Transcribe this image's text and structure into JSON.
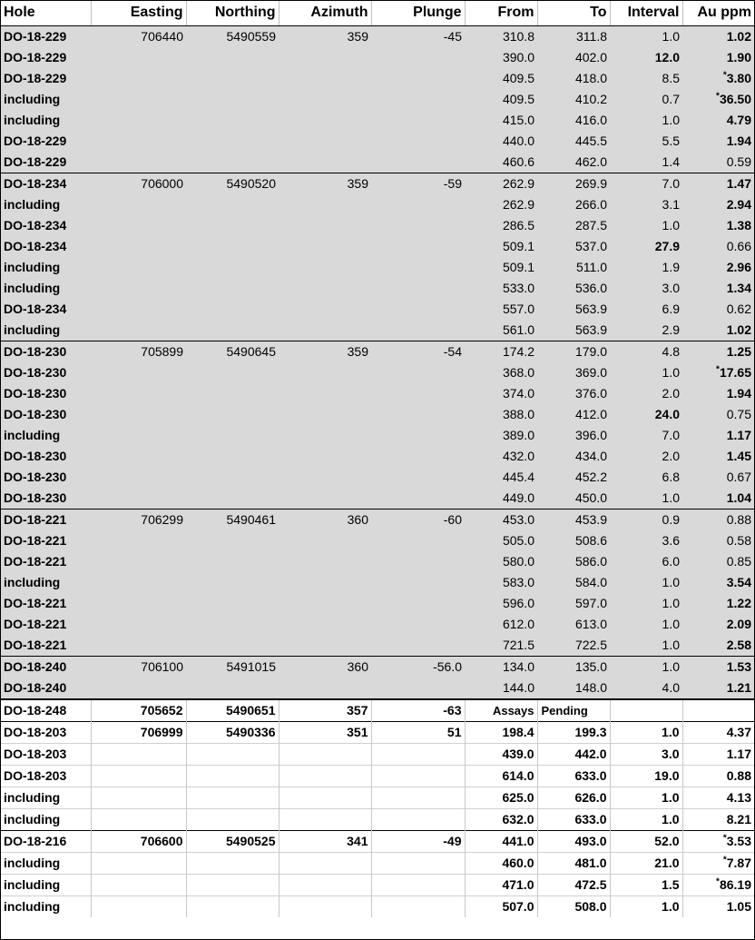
{
  "columns": [
    "Hole",
    "Easting",
    "Northing",
    "Azimuth",
    "Plunge",
    "From",
    "To",
    "Interval",
    "Au ppm"
  ],
  "groups": [
    {
      "style": "shaded",
      "rows": [
        {
          "hole": "DO-18-229",
          "easting": "706440",
          "northing": "5490559",
          "azimuth": "359",
          "plunge": "-45",
          "from": "310.8",
          "to": "311.8",
          "interval": "1.0",
          "au": "1.02",
          "au_bold": true
        },
        {
          "hole": "DO-18-229",
          "from": "390.0",
          "to": "402.0",
          "interval": "12.0",
          "interval_bold": true,
          "au": "1.90",
          "au_bold": true
        },
        {
          "hole": "DO-18-229",
          "from": "409.5",
          "to": "418.0",
          "interval": "8.5",
          "au": "3.80",
          "au_bold": true,
          "au_ast": true
        },
        {
          "hole": "including",
          "from": "409.5",
          "to": "410.2",
          "interval": "0.7",
          "au": "36.50",
          "au_bold": true,
          "au_ast": true
        },
        {
          "hole": "including",
          "from": "415.0",
          "to": "416.0",
          "interval": "1.0",
          "au": "4.79",
          "au_bold": true
        },
        {
          "hole": "DO-18-229",
          "from": "440.0",
          "to": "445.5",
          "interval": "5.5",
          "au": "1.94",
          "au_bold": true
        },
        {
          "hole": "DO-18-229",
          "from": "460.6",
          "to": "462.0",
          "interval": "1.4",
          "au": "0.59"
        }
      ]
    },
    {
      "style": "shaded",
      "rows": [
        {
          "hole": "DO-18-234",
          "easting": "706000",
          "northing": "5490520",
          "azimuth": "359",
          "plunge": "-59",
          "from": "262.9",
          "to": "269.9",
          "interval": "7.0",
          "au": "1.47",
          "au_bold": true
        },
        {
          "hole": "including",
          "from": "262.9",
          "to": "266.0",
          "interval": "3.1",
          "au": "2.94",
          "au_bold": true
        },
        {
          "hole": "DO-18-234",
          "from": "286.5",
          "to": "287.5",
          "interval": "1.0",
          "au": "1.38",
          "au_bold": true
        },
        {
          "hole": "DO-18-234",
          "from": "509.1",
          "to": "537.0",
          "interval": "27.9",
          "interval_bold": true,
          "au": "0.66"
        },
        {
          "hole": "including",
          "from": "509.1",
          "to": "511.0",
          "interval": "1.9",
          "au": "2.96",
          "au_bold": true
        },
        {
          "hole": "including",
          "from": "533.0",
          "to": "536.0",
          "interval": "3.0",
          "au": "1.34",
          "au_bold": true
        },
        {
          "hole": "DO-18-234",
          "from": "557.0",
          "to": "563.9",
          "interval": "6.9",
          "au": "0.62"
        },
        {
          "hole": "including",
          "from": "561.0",
          "to": "563.9",
          "interval": "2.9",
          "au": "1.02",
          "au_bold": true
        }
      ]
    },
    {
      "style": "shaded",
      "rows": [
        {
          "hole": "DO-18-230",
          "easting": "705899",
          "northing": "5490645",
          "azimuth": "359",
          "plunge": "-54",
          "from": "174.2",
          "to": "179.0",
          "interval": "4.8",
          "au": "1.25",
          "au_bold": true
        },
        {
          "hole": "DO-18-230",
          "from": "368.0",
          "to": "369.0",
          "interval": "1.0",
          "au": "17.65",
          "au_bold": true,
          "au_ast": true
        },
        {
          "hole": "DO-18-230",
          "from": "374.0",
          "to": "376.0",
          "interval": "2.0",
          "au": "1.94",
          "au_bold": true
        },
        {
          "hole": "DO-18-230",
          "from": "388.0",
          "to": "412.0",
          "interval": "24.0",
          "interval_bold": true,
          "au": "0.75"
        },
        {
          "hole": "including",
          "from": "389.0",
          "to": "396.0",
          "interval": "7.0",
          "au": "1.17",
          "au_bold": true
        },
        {
          "hole": "DO-18-230",
          "from": "432.0",
          "to": "434.0",
          "interval": "2.0",
          "au": "1.45",
          "au_bold": true
        },
        {
          "hole": "DO-18-230",
          "from": "445.4",
          "to": "452.2",
          "interval": "6.8",
          "au": "0.67"
        },
        {
          "hole": "DO-18-230",
          "from": "449.0",
          "to": "450.0",
          "interval": "1.0",
          "au": "1.04",
          "au_bold": true
        }
      ]
    },
    {
      "style": "shaded",
      "rows": [
        {
          "hole": "DO-18-221",
          "easting": "706299",
          "northing": "5490461",
          "azimuth": "360",
          "plunge": "-60",
          "from": "453.0",
          "to": "453.9",
          "interval": "0.9",
          "au": "0.88"
        },
        {
          "hole": "DO-18-221",
          "from": "505.0",
          "to": "508.6",
          "interval": "3.6",
          "au": "0.58"
        },
        {
          "hole": "DO-18-221",
          "from": "580.0",
          "to": "586.0",
          "interval": "6.0",
          "au": "0.85"
        },
        {
          "hole": "including",
          "from": "583.0",
          "to": "584.0",
          "interval": "1.0",
          "au": "3.54",
          "au_bold": true
        },
        {
          "hole": "DO-18-221",
          "from": "596.0",
          "to": "597.0",
          "interval": "1.0",
          "au": "1.22",
          "au_bold": true
        },
        {
          "hole": "DO-18-221",
          "from": "612.0",
          "to": "613.0",
          "interval": "1.0",
          "au": "2.09",
          "au_bold": true
        },
        {
          "hole": "DO-18-221",
          "from": "721.5",
          "to": "722.5",
          "interval": "1.0",
          "au": "2.58",
          "au_bold": true
        }
      ]
    },
    {
      "style": "shaded",
      "rows": [
        {
          "hole": "DO-18-240",
          "easting": "706100",
          "northing": "5491015",
          "azimuth": "360",
          "plunge": "-56.0",
          "from": "134.0",
          "to": "135.0",
          "interval": "1.0",
          "au": "1.53",
          "au_bold": true
        },
        {
          "hole": "DO-18-240",
          "from": "144.0",
          "to": "148.0",
          "interval": "4.0",
          "au": "1.21",
          "au_bold": true
        }
      ]
    },
    {
      "style": "pending",
      "rows": [
        {
          "hole": "DO-18-248",
          "easting": "705652",
          "northing": "5490651",
          "azimuth": "357",
          "plunge": "-63",
          "from": "Assays",
          "to": "Pending",
          "interval": "",
          "au": ""
        }
      ]
    },
    {
      "style": "white",
      "rows": [
        {
          "hole": "DO-18-203",
          "easting": "706999",
          "northing": "5490336",
          "azimuth": "351",
          "plunge": "51",
          "from": "198.4",
          "to": "199.3",
          "interval": "1.0",
          "au": "4.37",
          "au_bold": true
        },
        {
          "hole": "DO-18-203",
          "from": "439.0",
          "to": "442.0",
          "interval": "3.0",
          "au": "1.17",
          "au_bold": true
        },
        {
          "hole": "DO-18-203",
          "from": "614.0",
          "to": "633.0",
          "interval": "19.0",
          "interval_bold": true,
          "au": "0.88"
        },
        {
          "hole": "including",
          "from": "625.0",
          "to": "626.0",
          "interval": "1.0",
          "au": "4.13",
          "au_bold": true
        },
        {
          "hole": "including",
          "from": "632.0",
          "to": "633.0",
          "interval": "1.0",
          "au": "8.21",
          "au_bold": true
        }
      ]
    },
    {
      "style": "white",
      "rows": [
        {
          "hole": "DO-18-216",
          "easting": "706600",
          "northing": "5490525",
          "azimuth": "341",
          "plunge": "-49",
          "from": "441.0",
          "to": "493.0",
          "interval": "52.0",
          "interval_bold": true,
          "au": "3.53",
          "au_bold": true,
          "au_ast": true
        },
        {
          "hole": "including",
          "from": "460.0",
          "to": "481.0",
          "interval": "21.0",
          "interval_bold": true,
          "au": "7.87",
          "au_bold": true,
          "au_ast": true
        },
        {
          "hole": "including",
          "from": "471.0",
          "to": "472.5",
          "interval": "1.5",
          "au": "86.19",
          "au_bold": true,
          "au_ast": true
        },
        {
          "hole": "including",
          "from": "507.0",
          "to": "508.0",
          "interval": "1.0",
          "au": "1.05",
          "au_bold": true
        }
      ]
    }
  ],
  "asterisk": "*"
}
